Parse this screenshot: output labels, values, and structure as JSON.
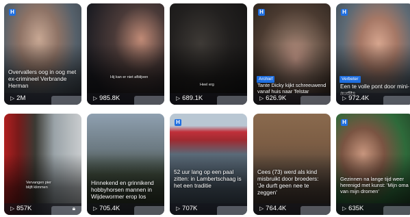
{
  "cards": [
    {
      "title": "Overvallers oog in oog met ex-crimineel Verbrande Herman",
      "views": "2M",
      "small": false,
      "tag": ""
    },
    {
      "title": "Hij kan er niet afblijven",
      "views": "985.8K",
      "small": true,
      "tag": ""
    },
    {
      "title": "Heel erg",
      "views": "689.1K",
      "small": true,
      "tag": ""
    },
    {
      "title": "Tante Dicky kijkt schreeuwend vanaf huis naar Telstar",
      "views": "626.9K",
      "small": false,
      "tag": "Archief"
    },
    {
      "title": "Een te volle pont door mini-audits",
      "views": "972.4K",
      "small": false,
      "tag": "Verbeter"
    },
    {
      "title": "Vervangen pier blijft klimmen",
      "views": "857K",
      "small": true,
      "tag": "",
      "lock": true
    },
    {
      "title": "Hinnekend en grinnikend hobbyhorsen mannen in Wijdewormer erop los",
      "views": "705.4K",
      "small": false,
      "tag": ""
    },
    {
      "title": "52 uur lang op een paal zitten: in Lambertschaag is het een traditie",
      "views": "707K",
      "small": false,
      "tag": ""
    },
    {
      "title": "Cees (73) werd als kind misbruikt door broeders: 'Je durft geen nee te zeggen'",
      "views": "764.4K",
      "small": false,
      "tag": ""
    },
    {
      "title": "Gezinnen na lange tijd weer herenigd met kunst: 'Mijn oma van mijn dromen'",
      "views": "635K",
      "small": false,
      "tag": ""
    }
  ],
  "logo_letter": "H",
  "colors": {
    "accent": "#1f6fe0"
  }
}
